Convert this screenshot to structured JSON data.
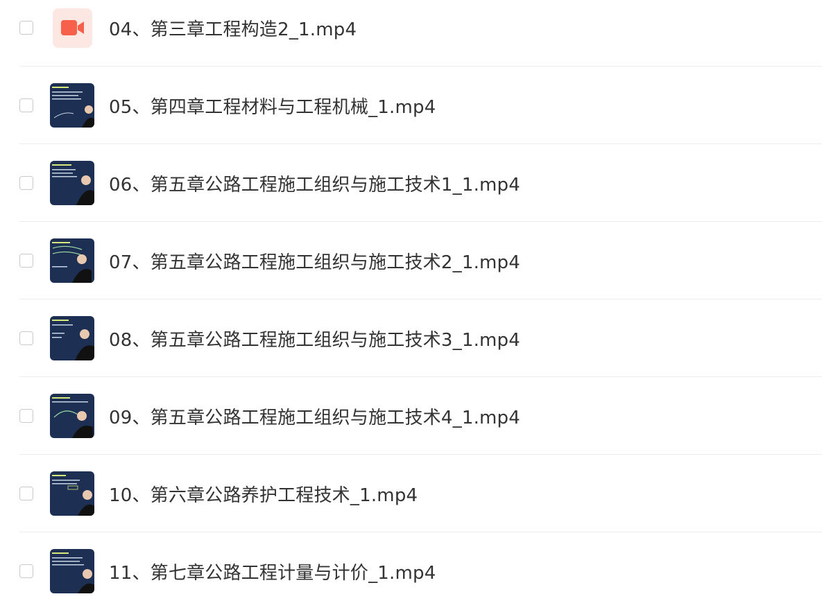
{
  "files": [
    {
      "name": "04、第三章工程构造2_1.mp4",
      "thumbnail": "video-file-icon"
    },
    {
      "name": "05、第四章工程材料与工程机械_1.mp4",
      "thumbnail": "lecture-video-thumbnail"
    },
    {
      "name": "06、第五章公路工程施工组织与施工技术1_1.mp4",
      "thumbnail": "lecture-video-thumbnail"
    },
    {
      "name": "07、第五章公路工程施工组织与施工技术2_1.mp4",
      "thumbnail": "lecture-video-thumbnail"
    },
    {
      "name": "08、第五章公路工程施工组织与施工技术3_1.mp4",
      "thumbnail": "lecture-video-thumbnail"
    },
    {
      "name": "09、第五章公路工程施工组织与施工技术4_1.mp4",
      "thumbnail": "lecture-video-thumbnail"
    },
    {
      "name": "10、第六章公路养护工程技术_1.mp4",
      "thumbnail": "lecture-video-thumbnail"
    },
    {
      "name": "11、第七章公路工程计量与计价_1.mp4",
      "thumbnail": "lecture-video-thumbnail"
    }
  ],
  "colors": {
    "video_icon": "#f7614b",
    "video_icon_bg": "#fde7e3",
    "thumb_bg": "#1d2f52",
    "text": "#333333",
    "divider": "#ececec"
  }
}
